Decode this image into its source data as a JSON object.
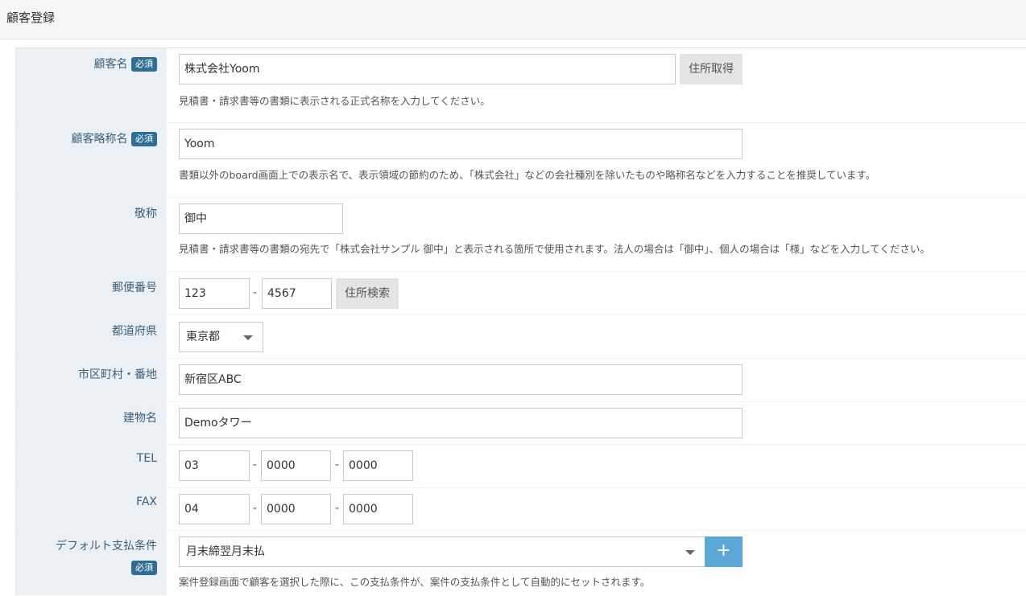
{
  "page": {
    "title": "顧客登録"
  },
  "required_badge": "必須",
  "customer_name": {
    "label": "顧客名",
    "value": "株式会社Yoom",
    "button": "住所取得",
    "help": "見積書・請求書等の書類に表示される正式名称を入力してください。"
  },
  "short_name": {
    "label": "顧客略称名",
    "value": "Yoom",
    "help": "書類以外のboard画面上での表示名で、表示領域の節約のため、「株式会社」などの会社種別を除いたものや略称名などを入力することを推奨しています。"
  },
  "honorific": {
    "label": "敬称",
    "value": "御中",
    "help": "見積書・請求書等の書類の宛先で「株式会社サンプル 御中」と表示される箇所で使用されます。法人の場合は「御中」、個人の場合は「様」などを入力してください。"
  },
  "postal": {
    "label": "郵便番号",
    "part1": "123",
    "separator": "-",
    "part2": "4567",
    "button": "住所検索"
  },
  "prefecture": {
    "label": "都道府県",
    "selected": "東京都"
  },
  "city": {
    "label": "市区町村・番地",
    "value": "新宿区ABC"
  },
  "building": {
    "label": "建物名",
    "value": "Demoタワー"
  },
  "tel": {
    "label": "TEL",
    "part1": "03",
    "part2": "0000",
    "part3": "0000",
    "separator": "-"
  },
  "fax": {
    "label": "FAX",
    "part1": "04",
    "part2": "0000",
    "part3": "0000",
    "separator": "-"
  },
  "payment_terms": {
    "label": "デフォルト支払条件",
    "selected": "月末締翌月末払",
    "add_button": "+",
    "help": "案件登録画面で顧客を選択した際に、この支払条件が、案件の支払条件として自動的にセットされます。"
  }
}
